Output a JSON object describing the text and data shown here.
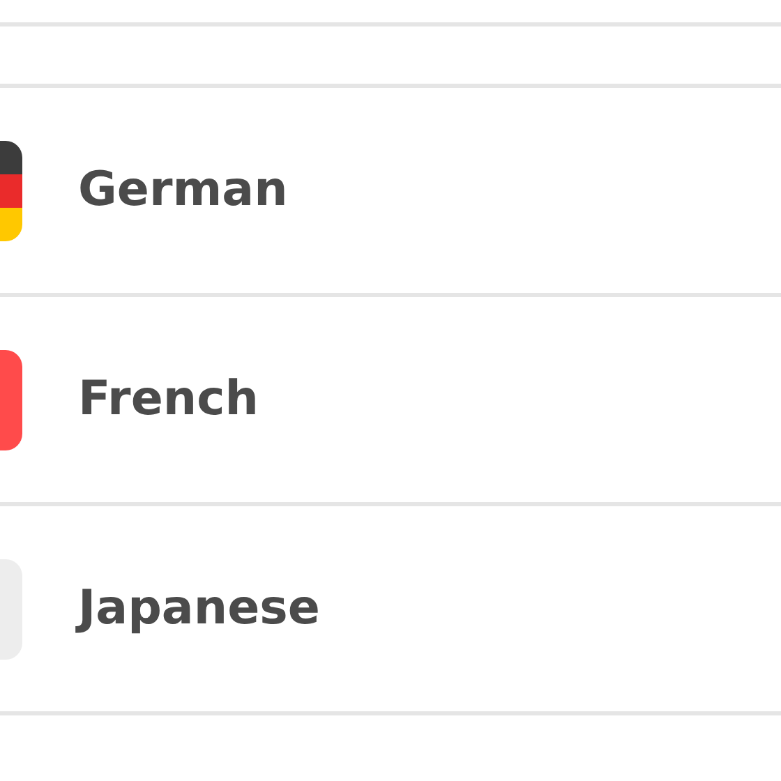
{
  "languages": [
    {
      "name": "German",
      "kind": "de"
    },
    {
      "name": "French",
      "kind": "fr"
    },
    {
      "name": "Japanese",
      "kind": "jp"
    }
  ]
}
